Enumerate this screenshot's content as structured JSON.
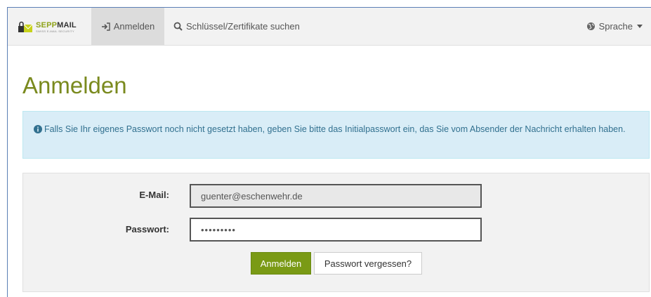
{
  "brand": {
    "name_a": "SEPP",
    "name_b": "MAIL",
    "tagline": "SWISS E-MAIL SECURITY"
  },
  "nav": {
    "login_label": "Anmelden",
    "search_label": "Schlüssel/Zertifikate suchen",
    "language_label": "Sprache"
  },
  "page": {
    "title": "Anmelden"
  },
  "alert": {
    "text": "Falls Sie Ihr eigenes Passwort noch nicht gesetzt haben, geben Sie bitte das Initialpasswort ein, das Sie vom Absender der Nachricht erhalten haben."
  },
  "form": {
    "email_label": "E-Mail:",
    "email_value": "guenter@eschenwehr.de",
    "password_label": "Passwort:",
    "password_value": "•••••••••",
    "submit_label": "Anmelden",
    "forgot_label": "Passwort vergessen?"
  },
  "colors": {
    "accent": "#7a9a15",
    "title": "#7a8a1e",
    "alert_bg": "#d9edf7",
    "alert_text": "#31708f"
  },
  "icons": {
    "login": "sign-in-icon",
    "search": "search-icon",
    "language": "globe-icon",
    "info": "info-circle-icon"
  }
}
